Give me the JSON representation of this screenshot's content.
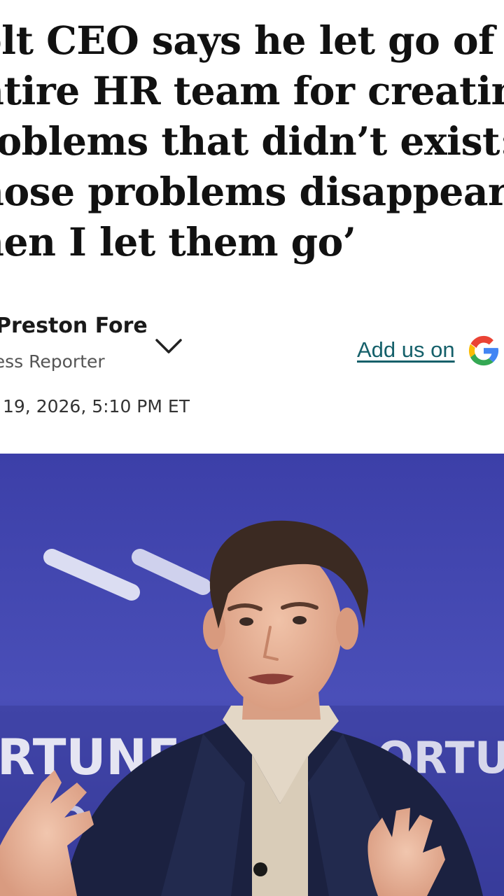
{
  "article": {
    "headline_lines": [
      "olt CEO says he let go of his",
      "ntire HR team for creating",
      "roblems that didn’t exist:",
      "hose problems disappeared",
      "hen I let them go’"
    ],
    "author_name": "Preston Fore",
    "author_title": "cess Reporter",
    "date": "19, 2026, 5:10 PM ET"
  },
  "actions": {
    "add_us_label": "Add us on",
    "add_us_icon": "google-icon",
    "expand_icon": "chevron-down-icon"
  },
  "photo": {
    "backdrop_texts": [
      "RTUNE",
      "FO",
      "ORTUN"
    ]
  },
  "colors": {
    "link": "#15606a",
    "backdrop": "#4446b0"
  }
}
